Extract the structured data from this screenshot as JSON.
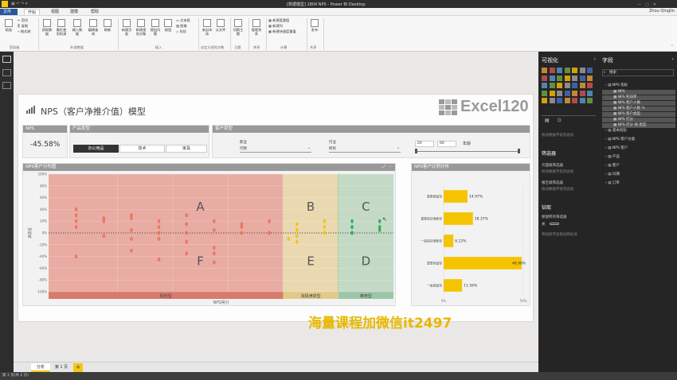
{
  "app": {
    "window_title": "[数据模型] 1804 NPS - Power BI Desktop",
    "user": "Zhou Qinglin"
  },
  "tabs": [
    "文件",
    "开始",
    "视图",
    "建模",
    "帮助"
  ],
  "ribbon": {
    "clipboard": {
      "paste": "粘贴",
      "cut": "剪切",
      "copy": "复制",
      "format": "格式刷",
      "group": "剪贴板"
    },
    "external": {
      "get_data": "获取数据",
      "recent": "最近使用的源",
      "enter": "输入数据",
      "edit": "编辑查询",
      "refresh": "刷新",
      "group": "外部数据"
    },
    "insert": {
      "new_page": "新建页面",
      "new_visual": "新建视觉对象",
      "ask": "提出问题",
      "buttons": "按钮",
      "textbox": "文本框",
      "image": "图像",
      "shapes": "形状",
      "group": "插入"
    },
    "custom": {
      "from_market": "来自市场",
      "from_file": "从文件",
      "group": "自定义视觉对象"
    },
    "themes": {
      "switch": "切换主题",
      "group": "主题"
    },
    "relationships": {
      "manage": "管理关系",
      "group": "关系"
    },
    "calc": {
      "new_measure": "新建度量值",
      "new_column": "新建列",
      "new_quick": "新建快速度量值",
      "group": "计算"
    },
    "share": {
      "publish": "发布",
      "group": "共享"
    }
  },
  "report": {
    "title": "NPS（客户净推介值）模型",
    "logo": "Excel120",
    "nps_card": {
      "label": "NPS",
      "value": "-45.58%"
    },
    "product_slicer": {
      "label": "产品类型",
      "options": [
        "办公用品",
        "技术",
        "家具"
      ],
      "selected": "办公用品"
    },
    "customer_slicer": {
      "label": "客户类型",
      "dept_label": "职业",
      "dept_value": "行政",
      "industry_label": "行业",
      "industry_value": "所有",
      "age_min": "20",
      "age_max": "60",
      "age_label": "年龄"
    },
    "scatter_title": "NPS客户分布图",
    "bar_title": "NPS客户比例分布",
    "zone_labels": [
      "A",
      "B",
      "C",
      "F",
      "E",
      "D"
    ],
    "band_labels": [
      "贬低型",
      "消极满意型",
      "推荐型"
    ],
    "x_axis_label": "NPS得分",
    "y_axis_label": "满意度"
  },
  "chart_data": [
    {
      "type": "scatter",
      "title": "NPS客户分布图",
      "xlabel": "NPS得分",
      "ylabel": "满意度",
      "yticks": [
        "100%",
        "80%",
        "60%",
        "40%",
        "20%",
        "0%",
        "-20%",
        "-40%",
        "-60%",
        "-80%",
        "-100%"
      ],
      "ylim": [
        -100,
        100
      ],
      "xlim": [
        0,
        10
      ],
      "series": [
        {
          "name": "贬低型",
          "color": "#e8705a",
          "points": [
            [
              1,
              40
            ],
            [
              1,
              30
            ],
            [
              1,
              20
            ],
            [
              1,
              10
            ],
            [
              1,
              -40
            ],
            [
              2,
              25
            ],
            [
              2,
              20
            ],
            [
              2,
              -5
            ],
            [
              3,
              30
            ],
            [
              3,
              25
            ],
            [
              3,
              5
            ],
            [
              3,
              -10
            ],
            [
              3,
              -30
            ],
            [
              4,
              20
            ],
            [
              4,
              10
            ],
            [
              4,
              0
            ],
            [
              4,
              -10
            ],
            [
              4,
              -45
            ],
            [
              5,
              30
            ],
            [
              5,
              15
            ],
            [
              5,
              0
            ],
            [
              5,
              -15
            ],
            [
              5,
              -35
            ],
            [
              6,
              20
            ],
            [
              6,
              5
            ],
            [
              6,
              -25
            ],
            [
              6,
              -35
            ],
            [
              6,
              -50
            ],
            [
              7,
              15
            ],
            [
              7,
              10
            ],
            [
              7,
              0
            ],
            [
              8,
              20
            ],
            [
              8,
              0
            ]
          ]
        },
        {
          "name": "消极满意型",
          "color": "#f2c200",
          "points": [
            [
              9,
              15
            ],
            [
              9,
              5
            ],
            [
              9,
              -5
            ],
            [
              9,
              -15
            ],
            [
              8.7,
              -10
            ],
            [
              10,
              20
            ],
            [
              10,
              10
            ],
            [
              10,
              0
            ]
          ]
        },
        {
          "name": "推荐型",
          "color": "#1aa84a",
          "points": [
            [
              11,
              20
            ],
            [
              11,
              10
            ],
            [
              11,
              0
            ],
            [
              12,
              20
            ],
            [
              12,
              10
            ],
            [
              12,
              5
            ]
          ]
        }
      ]
    },
    {
      "type": "bar",
      "title": "NPS客户比例分布",
      "categories": [
        "重要挽留型",
        "重要保持满意型",
        "一般保持满意型",
        "重要保留型",
        "一般挽留型"
      ],
      "values": [
        14.97,
        18.37,
        6.12,
        48.98,
        11.56
      ],
      "labels": [
        "14.97%",
        "18.37%",
        "6.12%",
        "48.98%",
        "11.56%"
      ],
      "xticks": [
        "0%",
        "50%"
      ],
      "xlim": [
        0,
        50
      ],
      "color": "#f5c400"
    }
  ],
  "viz_pane": {
    "title": "可视化",
    "filters_title": "筛选器",
    "filter_items": [
      "页面级筛选器",
      "拖动数据字段到此处",
      "报告级筛选器",
      "拖动数据字段到此处"
    ],
    "drill_title": "钻取",
    "drill_items": [
      "保留所有筛选器",
      "关",
      "将钻取字段拖动到此处"
    ],
    "values_hint": "拖动数据字段到此处"
  },
  "fields_pane": {
    "title": "字段",
    "search": "搜索",
    "items": [
      {
        "label": "NPS 指标",
        "level": 0
      },
      {
        "label": "NPS",
        "level": 1
      },
      {
        "label": "NPS 利润率",
        "level": 1
      },
      {
        "label": "NPS 客户人数",
        "level": 1
      },
      {
        "label": "NPS 客户人数 %",
        "level": 1
      },
      {
        "label": "NPS 客户类型",
        "level": 1
      },
      {
        "label": "NPS 打分",
        "level": 1
      },
      {
        "label": "NPS 打分 按 类型",
        "level": 1
      },
      {
        "label": "基本指标",
        "level": 0
      },
      {
        "label": "NPS 客户分类",
        "level": 0
      },
      {
        "label": "NPS 客户",
        "level": 0
      },
      {
        "label": "产品",
        "level": 0
      },
      {
        "label": "客户",
        "level": 0
      },
      {
        "label": "日期",
        "level": 0
      },
      {
        "label": "订单",
        "level": 0
      }
    ]
  },
  "pages": [
    "分析",
    "第 1 页"
  ],
  "add_page": "+",
  "status": "第 1 页(共 2 页)",
  "watermark": "海量课程加微信it2497"
}
